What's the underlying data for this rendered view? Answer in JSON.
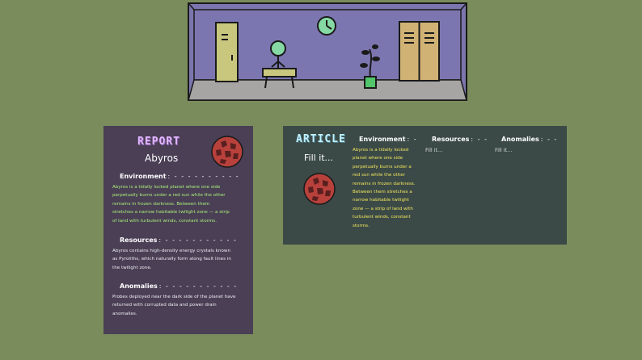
{
  "scene": {
    "room_colors": {
      "wall": "#7b76ad",
      "floor": "#a6a5a4",
      "outline": "#1a1a1a",
      "door_left": "#c9c77e",
      "door_right": "#d0b274",
      "accent_green": "#86d9a4"
    }
  },
  "report": {
    "title": "REPORT",
    "planet_name": "Abyros",
    "environment": {
      "heading": "Environment",
      "separator": ": - - - - - - - - - -",
      "lines": [
        "Abyros is a tidally locked planet where one side",
        "perpetually burns under a red sun while the other",
        "remains in frozen darkness. Between them",
        "stretches a narrow habitable twilight zone — a strip",
        "of land with turbulent winds, constant storms."
      ]
    },
    "resources": {
      "heading": "Resources",
      "separator": ": - - - - - - - - - - -",
      "lines": [
        "Abyros contains high-density energy crystals known",
        "as Pyroliths, which naturally form along fault lines in",
        "the twilight zone."
      ]
    },
    "anomalies": {
      "heading": "Anomalies",
      "separator": ": - - - - - - - - - - -",
      "lines": [
        "Probes deployed near the dark side of the planet have",
        "returned with corrupted data and power drain",
        "anomalies."
      ]
    }
  },
  "article": {
    "title": "ARTICLE",
    "fill_placeholder": "Fill it...",
    "columns": {
      "environment": {
        "heading": "Environment",
        "separator": ": -"
      },
      "resources": {
        "heading": "Resources",
        "separator": ": - -",
        "value": "Fill it..."
      },
      "anomalies": {
        "heading": "Anomalies",
        "separator": ": - -",
        "value": "Fill it..."
      }
    },
    "environment_lines": [
      "Abyros is a tidally locked",
      "planet where one side",
      "perpetually burns under a",
      "red sun while the other",
      "remains in frozen darkness.",
      "Between them stretches a",
      "narrow habitable twilight",
      "zone — a strip of land with",
      "turbulent winds, constant",
      "storms."
    ]
  }
}
